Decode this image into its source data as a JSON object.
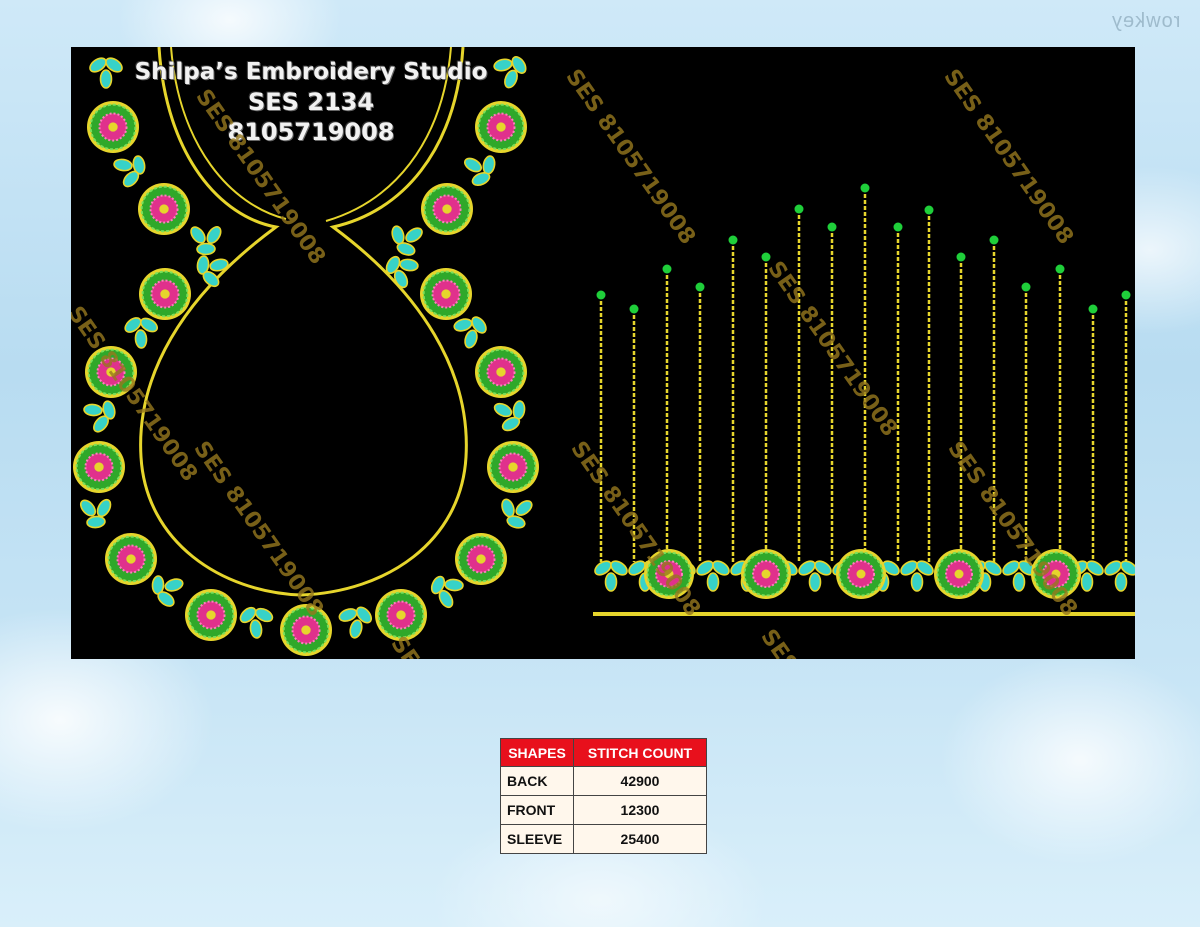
{
  "corner_mark": "rowkey",
  "studio": {
    "name": "Shilpa’s Embroidery Studio",
    "code": "SES 2134",
    "phone": "8105719008"
  },
  "watermark": "SES 8105719008",
  "watermark_partial": "SES",
  "colors": {
    "panel_bg": "#000000",
    "gold": "#e6d52c",
    "leaf": "#37d2c8",
    "flower_green": "#2fa82a",
    "flower_pink": "#e0318c",
    "bead": "#1fcf3a",
    "table_header": "#e8101c"
  },
  "stitch_table": {
    "headers": [
      "SHAPES",
      "STITCH COUNT"
    ],
    "rows": [
      {
        "shape": "BACK",
        "count": "42900"
      },
      {
        "shape": "FRONT",
        "count": "12300"
      },
      {
        "shape": "SLEEVE",
        "count": "25400"
      }
    ]
  }
}
